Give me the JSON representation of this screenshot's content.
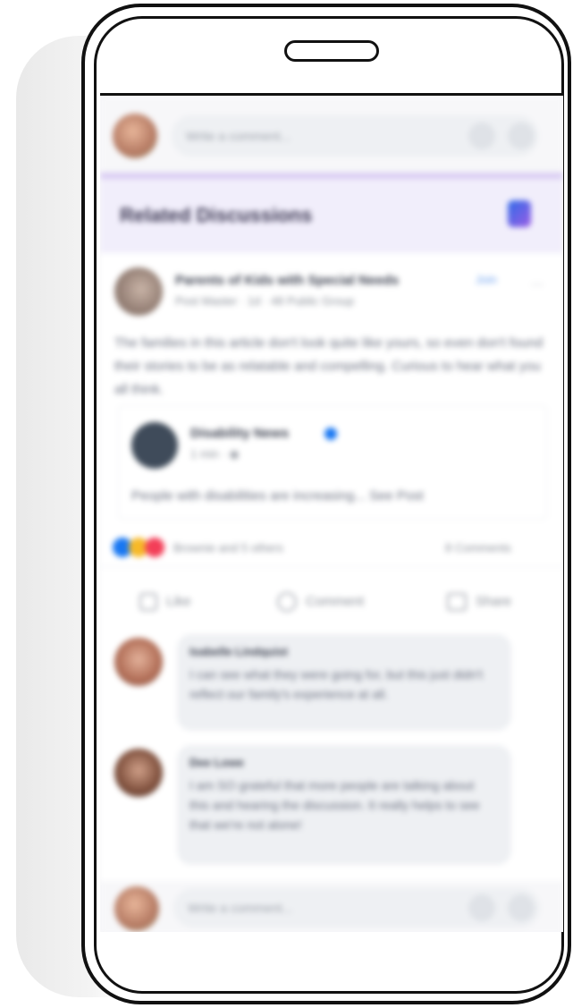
{
  "comment_box_top": {
    "placeholder": "Write a comment..."
  },
  "related": {
    "heading": "Related Discussions"
  },
  "post": {
    "group": "Parents of Kids with Special Needs",
    "group_badge": "Join",
    "meta": "Post Master · 1d · 48 Public Group",
    "body": "The families in this article don't look quite like yours, so even don't found their stories to be as relatable and compelling. Curious to hear what you all think.",
    "shared_source": "Disability News",
    "shared_meta": "1 min · ◉",
    "shared_text": "People with disabilities are increasing... See Post",
    "reactions": "Brownie and 5 others",
    "comments_count": "8 Comments",
    "actions": {
      "like": "Like",
      "comment": "Comment",
      "share": "Share"
    }
  },
  "comments": [
    {
      "name": "Isabelle Lindquist",
      "text": "I can see what they were going for, but this just didn't reflect our family's experience at all."
    },
    {
      "name": "Dee Lowe",
      "text": "I am SO grateful that more people are talking about this and hearing the discussion. It really helps to see that we're not alone!"
    }
  ],
  "comment_box_bottom": {
    "placeholder": "Write a comment..."
  },
  "colors": {
    "accent": "#1877f2",
    "related_bg": "#f1eefb",
    "related_border": "#d9ccf3",
    "frame": "#111111"
  },
  "icons": [
    "camera-icon",
    "sticker-icon",
    "tag-icon",
    "more-icon",
    "verified-icon",
    "like-icon",
    "comment-icon",
    "share-icon"
  ]
}
